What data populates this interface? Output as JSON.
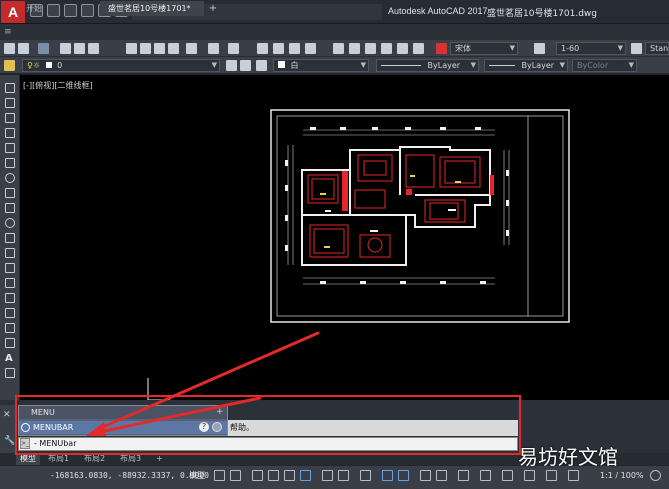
{
  "window": {
    "app_logo": "A",
    "app_title": "Autodesk AutoCAD 2017",
    "file_title": "盛世茗居10号楼1701.dwg"
  },
  "tabs": {
    "start": "开始",
    "file": "盛世茗居10号楼1701*",
    "add": "+"
  },
  "toolbar": {
    "font_combo": "宋体",
    "scale_combo": "1-60",
    "style_combo": "Stand",
    "layer_combo": "0",
    "color_combo": "白",
    "linetype_combo": "ByLayer",
    "lineweight_combo": "ByLayer",
    "plotstyle_combo": "ByColor"
  },
  "viewport": {
    "label": "[-][俯视][二维线框]"
  },
  "menu_popup": {
    "title": "MENU",
    "close": "+",
    "item": "MENUBAR",
    "help": "?"
  },
  "command": {
    "history_text": "帮助。",
    "prompt_icon": ">_",
    "input_text": "- MENUbar"
  },
  "layout_tabs": [
    "模型",
    "布局1",
    "布局2",
    "布局3"
  ],
  "layout_add": "+",
  "status": {
    "coords": "-168163.0830, -88932.3337, 0.0000",
    "model": "模型",
    "scale": "1:1 / 100%"
  },
  "watermark": "易坊好文馆",
  "colors": {
    "accent_red": "#e32a2a",
    "canvas": "#000000",
    "menu_highlight": "#5d77a4"
  }
}
